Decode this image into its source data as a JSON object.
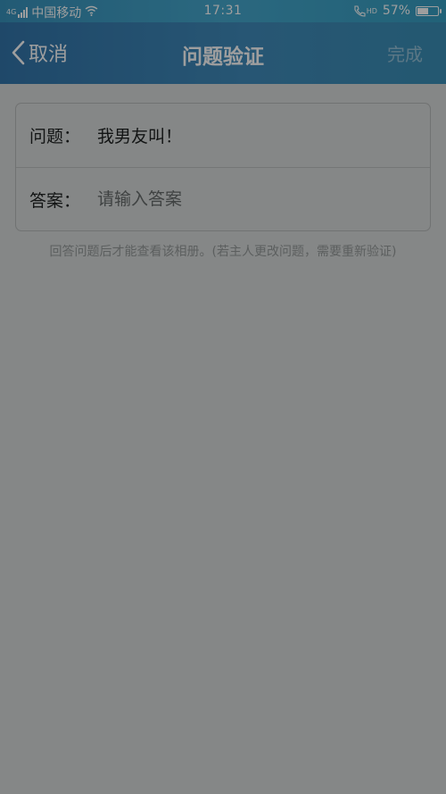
{
  "status_bar": {
    "carrier": "中国移动",
    "network_tag": "4G",
    "time": "17:31",
    "call_tag": "HD",
    "battery_percent": "57%",
    "battery_level": 0.57
  },
  "nav": {
    "back_label": "取消",
    "title": "问题验证",
    "done_label": "完成"
  },
  "form": {
    "question_label": "问题：",
    "question_value": "我男友叫！",
    "answer_label": "答案：",
    "answer_placeholder": "请输入答案",
    "answer_value": ""
  },
  "hint": "回答问题后才能查看该相册。(若主人更改问题，需要重新验证)",
  "icons": {
    "signal": "signal-icon",
    "wifi": "wifi-icon",
    "call": "phone-hd-icon",
    "battery": "battery-icon",
    "back": "chevron-left-icon"
  },
  "colors": {
    "nav_bar": "#1f78bf",
    "overlay_bg": "#858787"
  }
}
